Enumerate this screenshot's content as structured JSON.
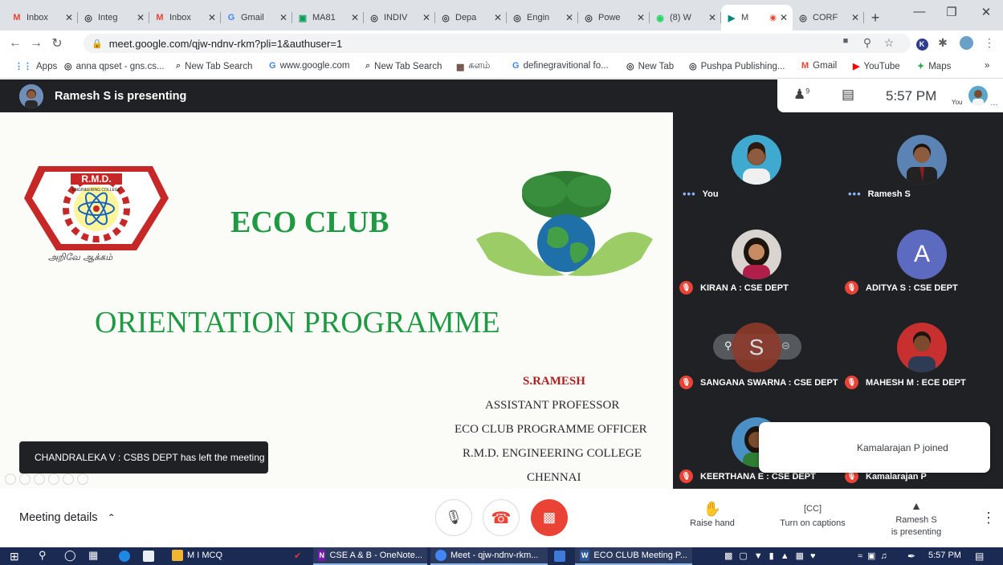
{
  "browser": {
    "tabs": [
      {
        "title": "Inbox",
        "icon": "M",
        "icon_color": "#ea4335"
      },
      {
        "title": "Integ",
        "icon": "◎",
        "icon_color": "#3c4043"
      },
      {
        "title": "Inbox",
        "icon": "M",
        "icon_color": "#ea4335"
      },
      {
        "title": "Gmail",
        "icon": "G",
        "icon_color": "#4285f4"
      },
      {
        "title": "MA81",
        "icon": "▣",
        "icon_color": "#0f9d58"
      },
      {
        "title": "INDIV",
        "icon": "◎",
        "icon_color": "#3c4043"
      },
      {
        "title": "Depa",
        "icon": "◎",
        "icon_color": "#3c4043"
      },
      {
        "title": "Engin",
        "icon": "◎",
        "icon_color": "#3c4043"
      },
      {
        "title": "Powe",
        "icon": "◎",
        "icon_color": "#3c4043"
      },
      {
        "title": "(8) W",
        "icon": "◉",
        "icon_color": "#25d366"
      },
      {
        "title": "M",
        "icon": "▶",
        "icon_color": "#00897b",
        "active": true
      },
      {
        "title": "CORF",
        "icon": "◎",
        "icon_color": "#3c4043"
      }
    ],
    "url": "meet.google.com/qjw-ndnv-rkm?pli=1&authuser=1",
    "bookmarks": [
      {
        "label": "Apps",
        "icon": "⋮⋮",
        "icon_color": "#4285f4"
      },
      {
        "label": "anna qpset - gns.cs...",
        "icon": "◎",
        "icon_color": "#3c4043"
      },
      {
        "label": "New Tab Search",
        "icon": "⌕",
        "icon_color": "#5f6368"
      },
      {
        "label": "www.google.com",
        "icon": "G",
        "icon_color": "#4285f4"
      },
      {
        "label": "New Tab Search",
        "icon": "⌕",
        "icon_color": "#5f6368"
      },
      {
        "label": "களம்",
        "icon": "▩",
        "icon_color": "#6d4c41"
      },
      {
        "label": "definegravitional fo...",
        "icon": "G",
        "icon_color": "#4285f4"
      },
      {
        "label": "New Tab",
        "icon": "◎",
        "icon_color": "#3c4043"
      },
      {
        "label": "Pushpa Publishing...",
        "icon": "◎",
        "icon_color": "#3c4043"
      },
      {
        "label": "Gmail",
        "icon": "M",
        "icon_color": "#ea4335"
      },
      {
        "label": "YouTube",
        "icon": "▶",
        "icon_color": "#ff0000"
      },
      {
        "label": "Maps",
        "icon": "✦",
        "icon_color": "#34a853"
      }
    ],
    "more_bookmarks": "»"
  },
  "meet": {
    "presenting_text": "Ramesh S is presenting",
    "participant_count": "9",
    "time": "5:57 PM",
    "you_label": "You",
    "meeting_details": "Meeting details"
  },
  "slide": {
    "logo_text": "R.M.D.",
    "logo_sub": "ENGINEERING COLLEGE",
    "logo_motto": "அறிவே ஆக்கம்",
    "title": "ECO CLUB",
    "subtitle": "ORIENTATION PROGRAMME",
    "presenter_name": "S.RAMESH",
    "lines": [
      "ASSISTANT PROFESSOR",
      "ECO CLUB PROGRAMME OFFICER",
      "R.M.D. ENGINEERING COLLEGE",
      "CHENNAI"
    ]
  },
  "participants": [
    {
      "name": "You",
      "muted": false
    },
    {
      "name": "Ramesh S",
      "muted": false
    },
    {
      "name": "KIRAN A : CSE DEPT",
      "muted": true
    },
    {
      "name": "ADITYA S : CSE DEPT",
      "muted": true,
      "initial": "A"
    },
    {
      "name": "SANGANA SWARNA : CSE DEPT",
      "muted": true,
      "initial": "S"
    },
    {
      "name": "MAHESH M : ECE DEPT",
      "muted": true
    },
    {
      "name": "KEERTHANA E : CSE DEPT",
      "muted": true
    },
    {
      "name": "Kamalarajan P",
      "muted": true
    }
  ],
  "notifications": {
    "left_meeting": "CHANDRALEKA V : CSBS DEPT has left the meeting",
    "joined": "Kamalarajan P joined"
  },
  "bottom_actions": {
    "raise_hand": "Raise hand",
    "captions": "Turn on captions",
    "presenting_line1": "Ramesh S",
    "presenting_line2": "is presenting"
  },
  "taskbar": {
    "apps": [
      {
        "label": "M I MCQ",
        "icon_color": "#f2b531"
      },
      {
        "label": "CSE A & B - OneNote...",
        "icon_color": "#7719aa"
      },
      {
        "label": "Meet - qjw-ndnv-rkm...",
        "icon_color": "#4285f4"
      },
      {
        "label": "ECO CLUB Meeting P...",
        "icon_color": "#2b579a"
      }
    ],
    "clock": "5:57 PM"
  },
  "colors": {
    "meet_dark": "#202124",
    "end_call": "#ea4335",
    "slide_green": "#1e9a43",
    "slide_name_red": "#b01e1e",
    "taskbar": "#1b2a52"
  }
}
